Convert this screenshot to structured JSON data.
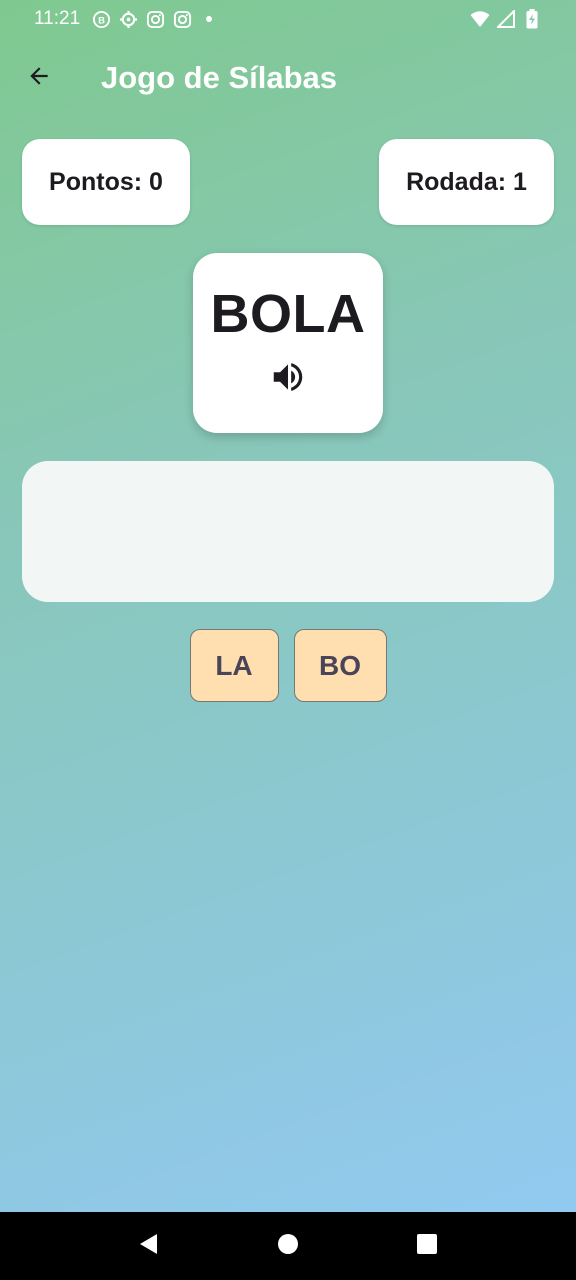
{
  "status_bar": {
    "time": "11:21",
    "notification_icons": [
      "b-badge-icon",
      "settings-gear-icon",
      "instagram-icon",
      "instagram-icon",
      "dot-icon"
    ],
    "system_icons": [
      "wifi-icon",
      "signal-icon",
      "battery-charging-icon"
    ]
  },
  "app_bar": {
    "title": "Jogo de Sílabas",
    "back_icon": "arrow-back-icon"
  },
  "scoreboard": {
    "points_label": "Pontos: 0",
    "round_label": "Rodada: 1"
  },
  "word_card": {
    "word": "BOLA",
    "speaker_icon": "volume-up-icon"
  },
  "drop_area": {
    "placed_syllables": []
  },
  "syllables": [
    {
      "text": "LA"
    },
    {
      "text": "BO"
    }
  ],
  "nav_bar": {
    "buttons": [
      "back-triangle-icon",
      "home-circle-icon",
      "recents-square-icon"
    ]
  },
  "colors": {
    "background_start": "#7fc98f",
    "background_end": "#93c9f5",
    "tile_fill": "#ffdeb0",
    "tile_text": "#4a4458",
    "card": "#ffffff",
    "drop_area": "#f2f7f6"
  }
}
